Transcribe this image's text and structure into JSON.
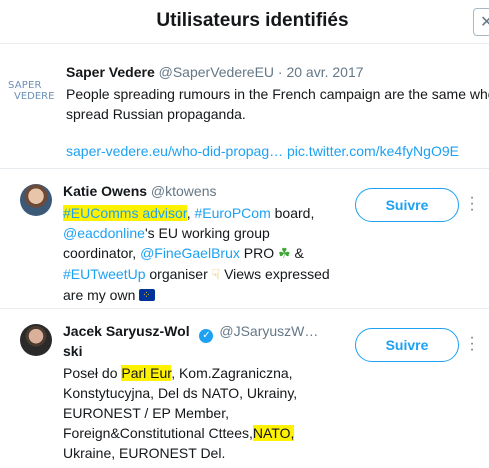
{
  "modal": {
    "title": "Utilisateurs identifiés",
    "close_icon": "close-icon"
  },
  "tweet": {
    "logo_text_1": "SAPER",
    "logo_text_2": "VEDERE",
    "name": "Saper Vedere",
    "handle": "@SaperVedereEU",
    "separator": "·",
    "date": "20 avr. 2017",
    "text": "People spreading rumours in the French campaign are the same who spread Russian propaganda.",
    "link_1": "saper-vedere.eu/who-did-propag…",
    "link_2": "pic.twitter.com/ke4fyNgO9E"
  },
  "users": [
    {
      "name": "Katie Owens",
      "handle": "@ktowens",
      "follow_label": "Suivre",
      "bio": {
        "t1": "#EUComms advisor",
        "t2": ",",
        "t3": "#EuroPCom",
        "t4": "board,",
        "t5": "@eacdonline",
        "t6": "'s EU working group coordinator,",
        "t7": "@FineGaelBrux",
        "t8": "PRO",
        "t9": "&",
        "t10": "#EUTweetUp",
        "t11": "organiser",
        "t12": "Views expressed are my own"
      },
      "emojis": [
        "clover-icon",
        "pointing-hand-icon",
        "eu-flag-icon"
      ]
    },
    {
      "name_part_1": "Jacek Saryusz-Wol",
      "name_part_2": "ski",
      "handle": "@JSaryuszW…",
      "verified": true,
      "follow_label": "Suivre",
      "bio": {
        "t1": "Poseł do",
        "t2": "Parl Eur",
        "t3": ", Kom.Zagraniczna, Konstytucyjna, Del ds NATO, Ukrainy, EURONEST / EP Member, Foreign&Constitutional Cttees,",
        "t4": "NATO,",
        "t5": "Ukraine, EURONEST Del."
      }
    }
  ],
  "colors": {
    "accent": "#1da1f2",
    "highlight": "#fff200",
    "muted": "#657786"
  }
}
